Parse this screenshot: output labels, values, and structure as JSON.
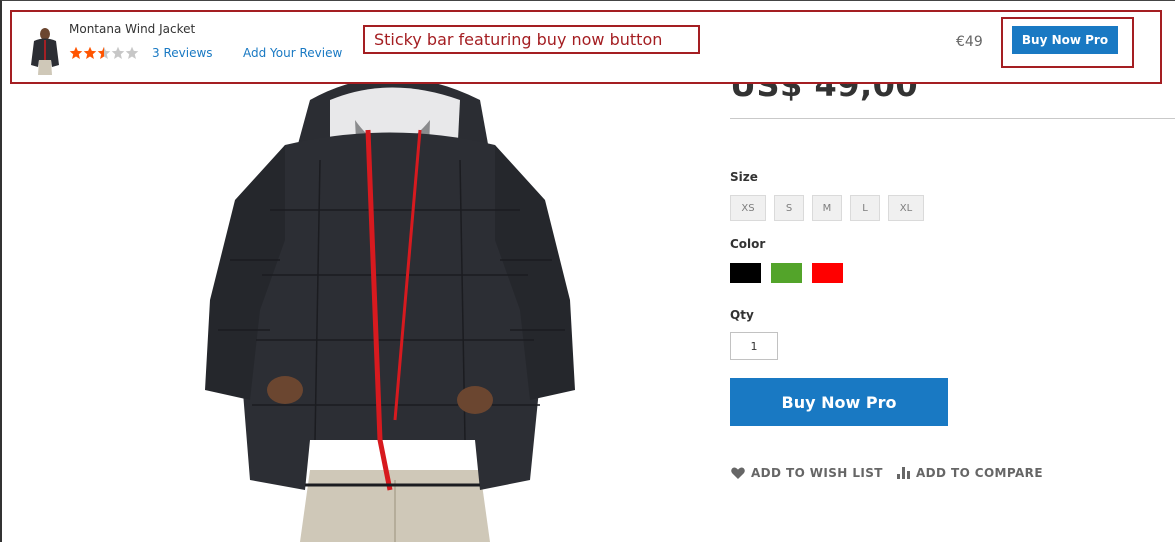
{
  "sticky_bar": {
    "product_name": "Montana Wind Jacket",
    "rating_stars": 2.5,
    "rating_max": 5,
    "review_count": "3",
    "reviews_label": "Reviews",
    "add_review": "Add Your Review",
    "annotation": "Sticky bar featuring buy now button",
    "price": "€49",
    "buy_label": "Buy Now Pro"
  },
  "product": {
    "price": "US$ 49,00",
    "size_label": "Size",
    "sizes": [
      "XS",
      "S",
      "M",
      "L",
      "XL"
    ],
    "color_label": "Color",
    "colors": [
      "#000000",
      "#53a42a",
      "#ff0000"
    ],
    "qty_label": "Qty",
    "qty_value": "1",
    "buy_label": "Buy Now Pro",
    "wishlist_label": "ADD TO WISH LIST",
    "compare_label": "ADD TO COMPARE"
  },
  "theme": {
    "accent": "#1979c3",
    "annotation_color": "#a41e22",
    "star_filled": "#ff5501",
    "star_empty": "#c7c7c7"
  },
  "icons": {
    "wishlist": "heart-icon",
    "compare": "bar-chart-icon"
  }
}
